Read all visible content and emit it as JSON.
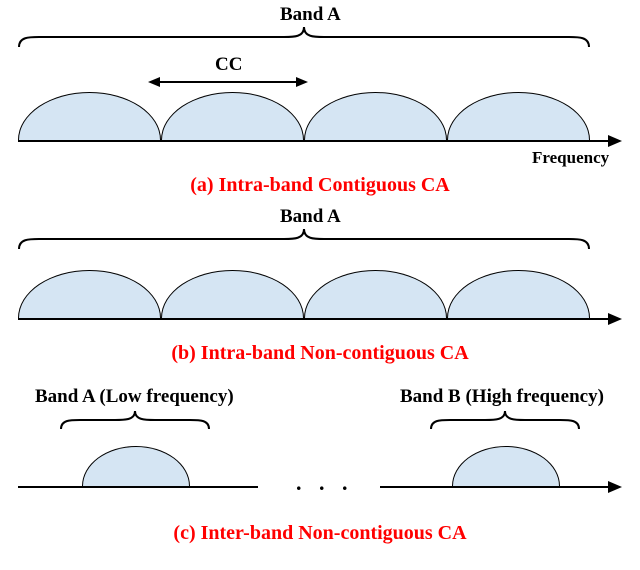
{
  "panel_a": {
    "band_label": "Band A",
    "cc_label": "CC",
    "freq_label": "Frequency",
    "caption": "(a) Intra-band Contiguous CA"
  },
  "panel_b": {
    "band_label": "Band A",
    "caption": "(b) Intra-band Non-contiguous CA"
  },
  "panel_c": {
    "band_a_label": "Band A (Low frequency)",
    "band_b_label": "Band B (High frequency)",
    "dots": ". . .",
    "caption": "(c) Inter-band Non-contiguous CA"
  }
}
